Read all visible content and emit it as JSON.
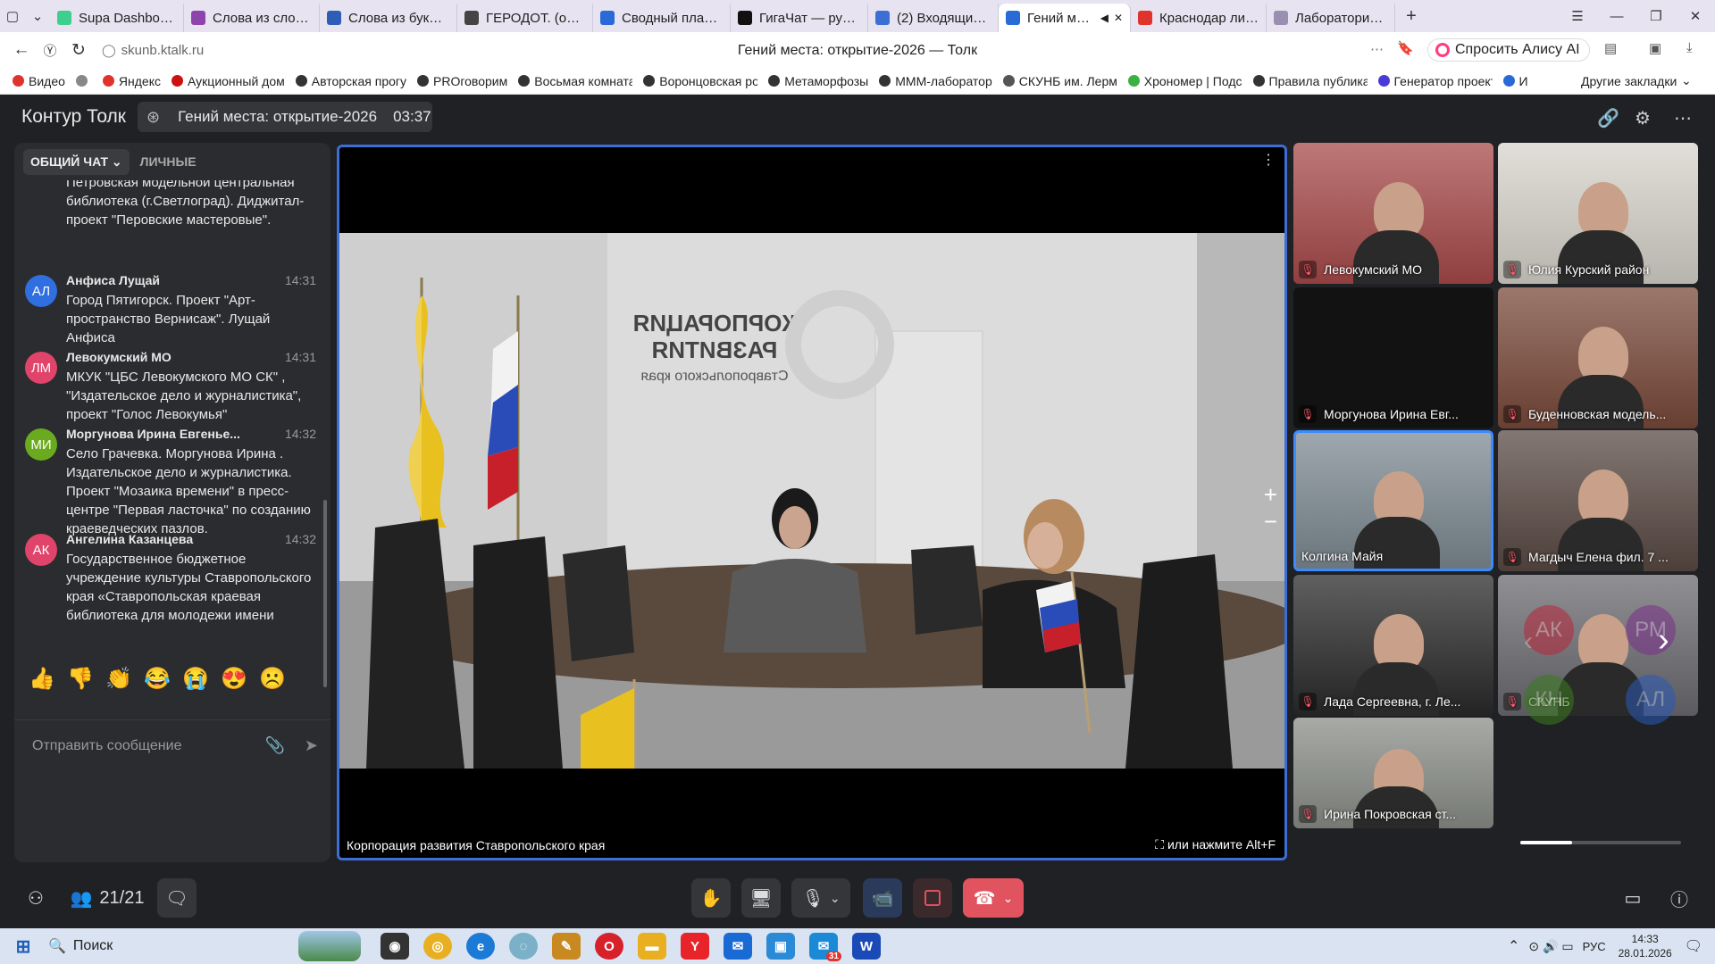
{
  "browser": {
    "tabs": [
      {
        "label": "Supa Dashboard",
        "color": "#3ecf8e",
        "active": false
      },
      {
        "label": "Слова из слова (о",
        "color": "#8e44ad",
        "active": false
      },
      {
        "label": "Слова из букв \"Л",
        "color": "#2e5db8",
        "active": false
      },
      {
        "label": "ГЕРОДОТ. (ок. 48",
        "color": "#444444",
        "active": false
      },
      {
        "label": "Сводный план ос",
        "color": "#2a6ad6",
        "active": false
      },
      {
        "label": "ГигаЧат — русско",
        "color": "#111111",
        "active": false
      },
      {
        "label": "(2) Входящие - По",
        "color": "#3d6ed6",
        "active": false
      },
      {
        "label": "Гений места",
        "color": "#2a6ad6",
        "active": true
      },
      {
        "label": "Краснодар литер",
        "color": "#e0332e",
        "active": false
      },
      {
        "label": "Лаборатория «PR",
        "color": "#9a8fb0",
        "active": false
      }
    ],
    "url": "skunb.ktalk.ru",
    "page_title": "Гений места: открытие-2026 — Толк",
    "alice": "Спросить Алису AI",
    "bookmarks": [
      {
        "label": "Видео",
        "color": "#e0332e"
      },
      {
        "label": "",
        "color": "#888888"
      },
      {
        "label": "Яндекс",
        "color": "#e0332e"
      },
      {
        "label": "Аукционный дом",
        "color": "#cc1111"
      },
      {
        "label": "Авторская прогу",
        "color": "#333333"
      },
      {
        "label": "PROговорим",
        "color": "#333333"
      },
      {
        "label": "Восьмая комната",
        "color": "#333333"
      },
      {
        "label": "Воронцовская ро",
        "color": "#333333"
      },
      {
        "label": "Метаморфозы",
        "color": "#333333"
      },
      {
        "label": "МММ-лаборатор",
        "color": "#333333"
      },
      {
        "label": "СКУНБ им. Лерм",
        "color": "#555555"
      },
      {
        "label": "Хрономер | Подс",
        "color": "#3cb043"
      },
      {
        "label": "Правила публика",
        "color": "#333333"
      },
      {
        "label": "Генератор проект",
        "color": "#4a3ad6"
      },
      {
        "label": "И",
        "color": "#2a6ad6"
      }
    ],
    "other_bookmarks": "Другие закладки"
  },
  "app": {
    "logo": "Контур Толк",
    "meeting_title": "Гений места: открытие-2026",
    "timer": "03:37"
  },
  "chat": {
    "tab_general": "ОБЩИЙ ЧАТ",
    "tab_private": "ЛИЧНЫЕ",
    "first_fragment": "Петровская модельной центральная библиотека (г.Светлоград). Диджитал-проект \"Перовские мастеровые\".",
    "messages": [
      {
        "initials": "АЛ",
        "author": "Анфиса Лущай",
        "time": "14:31",
        "text": "Город Пятигорск. Проект \"Арт-пространство Вернисаж\". Лущай Анфиса",
        "color": "#2f6fe0"
      },
      {
        "initials": "ЛМ",
        "author": "Левокумский МО",
        "time": "14:31",
        "text": "МКУК \"ЦБС Левокумского МО СК\" , \"Издательское дело и журналистика\", проект \"Голос Левокумья\"",
        "color": "#e0446a"
      },
      {
        "initials": "МИ",
        "author": "Моргунова Ирина Евгенье...",
        "time": "14:32",
        "text": "Село Грачевка. Моргунова Ирина . Издательское дело и журналистика. Проект \"Мозаика времени\" в пресс-центре \"Первая ласточка\" по созданию краеведческих пазлов.",
        "color": "#6aaa1e"
      },
      {
        "initials": "АК",
        "author": "Ангелина Казанцева",
        "time": "14:32",
        "text": "Государственное бюджетное учреждение культуры Ставропольского края «Ставропольская краевая библиотека для молодежи имени В.И.Слядневой» , креативный туризм и образование , проект «Литературный променад».",
        "color": "#e0446a"
      }
    ],
    "emojis": [
      "👍",
      "👎",
      "👏",
      "😂",
      "😭",
      "😍",
      "☹️"
    ],
    "input_placeholder": "Отправить сообщение"
  },
  "main_video": {
    "label": "Корпорация развития Ставропольского края",
    "fullscreen_hint": "или нажмите Alt+F",
    "sign_line1": "КОРПОРАЦИЯ",
    "sign_line2": "РАЗВИТИЯ",
    "sign_line3": "Ставропольского края"
  },
  "tiles": [
    {
      "name": "Левокумский МО",
      "bg": "#a84a4a"
    },
    {
      "name": "Юлия Курский район",
      "bg": "#d8d4cc"
    },
    {
      "name": "Моргунова Ирина Евг...",
      "bg": "#121212"
    },
    {
      "name": "Буденновская модель...",
      "bg": "#7a4a3a"
    },
    {
      "name": "Колгина Майя",
      "bg": "#7d8a92"
    },
    {
      "name": "Магдыч Елена фил. 7 ...",
      "bg": "#5a4a44"
    },
    {
      "name": "Лада Сергеевна, г. Ле...",
      "bg": "#2a2a2a"
    },
    {
      "name": "СКУНБ",
      "bg": "#6a6a70"
    },
    {
      "name": "Ирина Покровская ст...",
      "bg": "#8a8e88"
    }
  ],
  "more_participants": [
    {
      "initials": "АК",
      "color": "#b8273a"
    },
    {
      "initials": "РМ",
      "color": "#7a2f8a"
    },
    {
      "initials": "КН",
      "color": "#3b7a1e"
    },
    {
      "initials": "АЛ",
      "color": "#2a5ab8"
    }
  ],
  "bottom": {
    "participants": "21/21"
  },
  "taskbar": {
    "search": "Поиск",
    "lang": "РУС",
    "time": "14:33",
    "date": "28.01.2026",
    "mail_badge": "31"
  }
}
